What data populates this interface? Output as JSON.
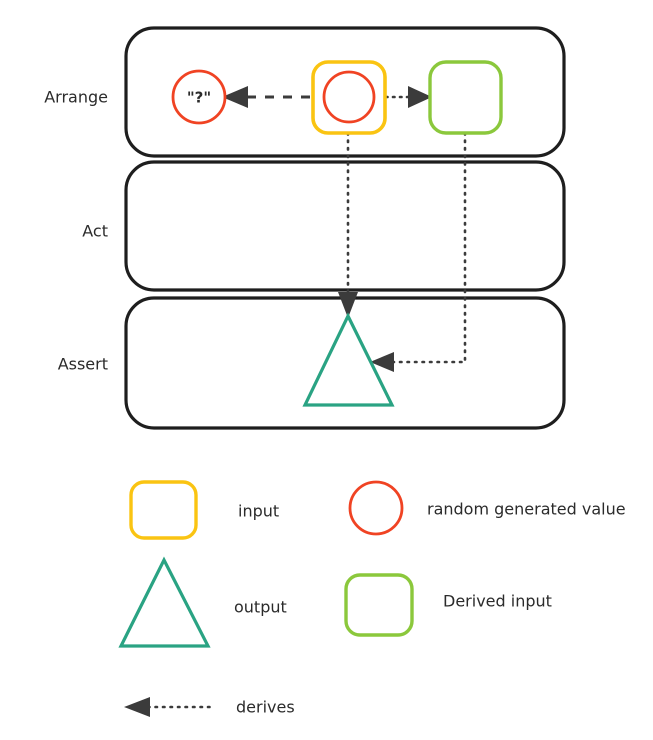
{
  "diagram": {
    "title": "",
    "lanes": [
      {
        "id": "arrange",
        "label": "Arrange"
      },
      {
        "id": "act",
        "label": "Act"
      },
      {
        "id": "assert",
        "label": "Assert"
      }
    ],
    "nodes": [
      {
        "id": "question-value",
        "label": "\"?\"",
        "shape": "circle",
        "color": "#f04323",
        "lane": "arrange"
      },
      {
        "id": "input-box",
        "label": "",
        "shape": "rounded-square",
        "color": "#fac412",
        "lane": "arrange"
      },
      {
        "id": "input-random-value",
        "label": "",
        "shape": "circle",
        "color": "#f04323",
        "lane": "arrange"
      },
      {
        "id": "derived-input-box",
        "label": "",
        "shape": "rounded-square",
        "color": "#8bc83c",
        "lane": "arrange"
      },
      {
        "id": "output-triangle",
        "label": "",
        "shape": "triangle",
        "color": "#2aa383",
        "lane": "assert"
      }
    ],
    "edges": [
      {
        "id": "input-to-question",
        "from": "input-box",
        "to": "question-value",
        "style": "dashed",
        "label": ""
      },
      {
        "id": "input-to-derived",
        "from": "input-box",
        "to": "derived-input-box",
        "style": "dotted",
        "label": ""
      },
      {
        "id": "input-to-output",
        "from": "input-box",
        "to": "output-triangle",
        "style": "dotted",
        "label": ""
      },
      {
        "id": "derived-to-output",
        "from": "derived-input-box",
        "to": "output-triangle",
        "style": "dotted",
        "label": ""
      }
    ]
  },
  "legend": {
    "items": [
      {
        "id": "input",
        "label": "input",
        "shape": "rounded-square",
        "color": "#fac412"
      },
      {
        "id": "random-generated-value",
        "label": "random generated value",
        "shape": "circle",
        "color": "#f04323"
      },
      {
        "id": "output",
        "label": "output",
        "shape": "triangle",
        "color": "#2aa383"
      },
      {
        "id": "derived-input",
        "label": "Derived input",
        "shape": "rounded-square",
        "color": "#8bc83c"
      },
      {
        "id": "derives",
        "label": "derives",
        "shape": "dotted-arrow",
        "color": "#3b3b3b"
      }
    ]
  },
  "colors": {
    "lane_border": "#1e1e1e",
    "background": "#ffffff",
    "text": "#2b2b2b",
    "arrow": "#3b3b3b",
    "yellow": "#fac412",
    "red": "#f04323",
    "green": "#8bc83c",
    "teal": "#2aa383"
  }
}
